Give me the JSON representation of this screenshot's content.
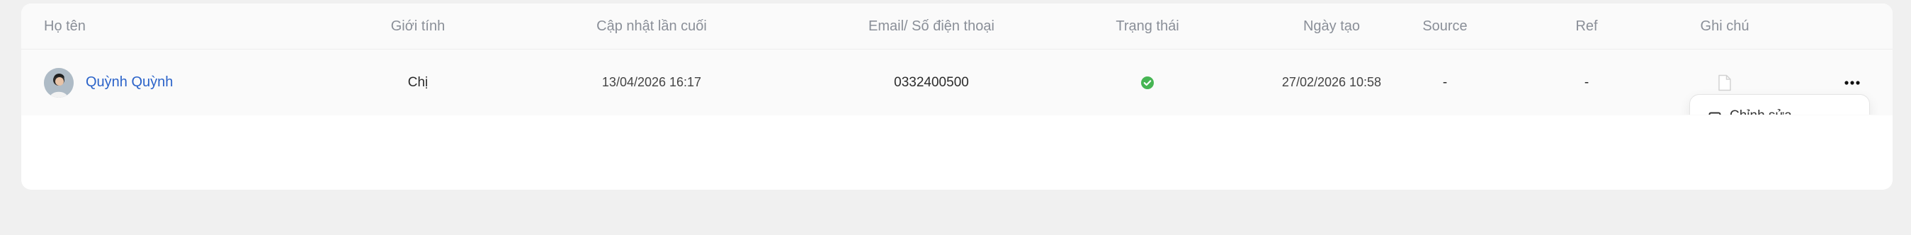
{
  "table": {
    "headers": {
      "name": "Họ tên",
      "gender": "Giới tính",
      "last_updated": "Cập nhật lần cuối",
      "contact": "Email/ Số điện thoại",
      "status": "Trạng thái",
      "created": "Ngày tạo",
      "source": "Source",
      "ref": "Ref",
      "note": "Ghi chú"
    },
    "rows": [
      {
        "name": "Quỳnh Quỳnh",
        "gender": "Chị",
        "last_updated": "13/04/2026 16:17",
        "contact": "0332400500",
        "status_icon": "check-circle-icon",
        "created": "27/02/2026 10:58",
        "source": "-",
        "ref": "-",
        "note_icon": "document-icon"
      }
    ]
  },
  "row_menu": {
    "first_item_label": "Chỉnh sửa",
    "first_item_icon": "edit-icon"
  },
  "colors": {
    "link": "#2b63c9",
    "status_active": "#46b553",
    "header_text": "#8a8f98"
  }
}
